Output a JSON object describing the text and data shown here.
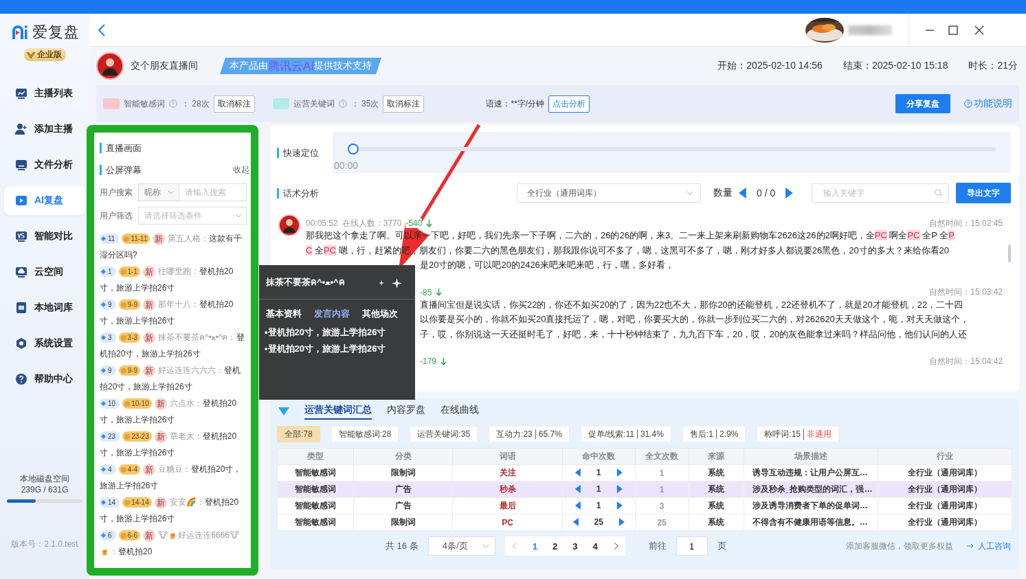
{
  "app": {
    "name": "爱复盘",
    "edition": "企业版"
  },
  "nav": [
    {
      "label": "主播列表",
      "kind": "chart",
      "selected": false
    },
    {
      "label": "添加主播",
      "kind": "user-plus",
      "selected": false
    },
    {
      "label": "文件分析",
      "kind": "monitor",
      "selected": false
    },
    {
      "label": "AI复盘",
      "kind": "play",
      "selected": true
    },
    {
      "label": "智能对比",
      "kind": "vs",
      "selected": false
    },
    {
      "label": "云空间",
      "kind": "cloud",
      "selected": false
    },
    {
      "label": "本地词库",
      "kind": "book",
      "selected": false
    },
    {
      "label": "系统设置",
      "kind": "gear",
      "selected": false
    },
    {
      "label": "帮助中心",
      "kind": "help",
      "selected": false
    }
  ],
  "disk": {
    "label": "本地磁盘空间",
    "usage": "239G / 631G",
    "level": 0.38
  },
  "version": "版本号：2.1.0.test",
  "stream": {
    "name": "交个朋友直播间",
    "banner": [
      {
        "text": "本产品由",
        "strong": false
      },
      {
        "text": "腾讯云AI",
        "strong": true
      },
      {
        "text": "提供技术支持",
        "strong": false
      }
    ],
    "start": "开始：2025-02-10 14:56",
    "end": "结束：2025-02-10 15:18",
    "duration": "时长：21分"
  },
  "legend": [
    {
      "label": "智能敏感词",
      "count": "： 28次",
      "action": "取消标注",
      "color": "#fbc5cd"
    },
    {
      "label": "运营关键词",
      "count": "： 35次",
      "action": "取消标注",
      "color": "#b3ebe8"
    }
  ],
  "speed": {
    "label": "语速：**字/分钟",
    "action": "点击分析"
  },
  "share_button": "分享复盘",
  "help_link": "功能说明",
  "left_panel": {
    "video_title": "直播画面",
    "danmaku_title": "公屏弹幕",
    "collapse": "收起",
    "search_label": "用户搜索",
    "search_type": "昵称",
    "search_placeholder": "请输入搜索",
    "filter_label": "用户筛选",
    "filter_placeholder": "请选择筛选条件",
    "comments": [
      {
        "level": "11",
        "fan": "11-11",
        "tag": "新",
        "name": "第五人格：",
        "text": "这款有干湿分区吗?"
      },
      {
        "level": "1",
        "fan": "1-1",
        "tag": "新",
        "name": "往哪里跑：",
        "text": "登机拍20寸，旅游上学拍26寸"
      },
      {
        "level": "9",
        "fan": "9-9",
        "tag": "新",
        "name": "那年十八：",
        "text": "登机拍20寸，旅游上学拍26寸"
      },
      {
        "level": "3",
        "fan": "3-3",
        "tag": "新",
        "name": "抹茶不要茶ค^•ﻌ•^ค：",
        "text": "登机拍20寸，旅游上学拍26寸"
      },
      {
        "level": "9",
        "fan": "9-9",
        "tag": "新",
        "name": "好运连连六六六：",
        "text": "登机拍20寸，旅游上学拍26寸"
      },
      {
        "level": "10",
        "fan": "10-10",
        "tag": "新",
        "name": "六点水：",
        "text": "登机拍20寸，旅游上学拍26寸"
      },
      {
        "level": "23",
        "fan": "23-23",
        "tag": "新",
        "name": "章老大：",
        "text": "登机拍20寸，旅游上学拍26寸"
      },
      {
        "level": "4",
        "fan": "4-4",
        "tag": "新",
        "name": "豆糖豆：",
        "text": "登机拍20寸，旅游上学拍26寸"
      },
      {
        "level": "14",
        "fan": "14-14",
        "tag": "新",
        "name": "安安🌈：",
        "text": "登机拍20寸，旅游上学拍26寸"
      },
      {
        "level": "6",
        "fan": "6-6",
        "tag": "新",
        "name": "🐮🍺好运连连6666🐮🍺：",
        "text": "登机拍20"
      }
    ]
  },
  "quick_locate": {
    "label": "快速定位",
    "time": "00:00",
    "level": 0
  },
  "analysis": {
    "label": "话术分析",
    "industry": "全行业（通用词库）",
    "count_label": "数量",
    "count": "0 / 0",
    "search_placeholder": "输入关键字",
    "export": "导出文字",
    "entries": [
      {
        "covered": false,
        "time": "00:05:52",
        "online": "在线人数：3770",
        "delta": "-540",
        "natural_time": "自然时间：15:02:45",
        "lines": [
          {
            "covered": false,
            "segments": [
              {
                "text": "那我把这个拿走了啊。可以亲一下吧，好吧，我们先亲一下子啊，二六的，26的26的啊，来3。二一来上架来刷新购物车2626这26的2啊好吧，全",
                "highlight": false
              },
              {
                "text": "PC",
                "highlight": true
              },
              {
                "text": " 啊全",
                "highlight": false
              },
              {
                "text": "PC",
                "highlight": true
              },
              {
                "text": " 全P 全",
                "highlight": false
              },
              {
                "text": "P",
                "highlight": true
              }
            ]
          },
          {
            "covered": false,
            "segments": [
              {
                "text": "C",
                "highlight": true
              },
              {
                "text": " 全",
                "highlight": false
              },
              {
                "text": "PC",
                "highlight": true
              },
              {
                "text": " 嗯，行，赶紧的吧，朋友们，你要二六的黑色朋友们，那我跟你说可不多了，嗯，这黑可不多了，嗯，刚才好多人都说要26黑色，20寸的多大？来给你看20",
                "highlight": false
              }
            ]
          },
          {
            "covered": true,
            "segments": [
              {
                "text": "是20寸的嗯，可以吧20的2426来吧来吧来吧，行，嘿，多好看，",
                "highlight": false
              }
            ]
          }
        ]
      },
      {
        "covered": true,
        "delta": "-85",
        "natural_time": "自然时间：15:03:42",
        "lines": [
          {
            "covered": true,
            "segments": [
              {
                "text": "直播间宝但是说实话，你买22的，你还不如买20的了，因为22也不大，那你20的还能登机，22还登机不了，就是20才能登机，22，二十四",
                "highlight": false
              }
            ]
          },
          {
            "covered": true,
            "segments": [
              {
                "text": "以你要是买小的，你就不如买20直接托运了，嗯，对吧，你要买大的，你就一步到位买二六的，对262620天天做这个，呃，对天天做这个，",
                "highlight": false
              }
            ]
          },
          {
            "covered": true,
            "segments": [
              {
                "text": "子，哎，你别说这一天还挺时毛了，好吧，来，十十秒钟结束了，九九百下车，20，哎，20的灰色能拿过来吗？样品问他，他们认问的人还",
                "highlight": false
              }
            ]
          }
        ]
      },
      {
        "covered": true,
        "delta": "-179",
        "natural_time": "自然时间：15:04:42"
      }
    ]
  },
  "popup": {
    "title": "抹茶不要茶ค^•ﻌ•^ค",
    "tabs": [
      {
        "label": "基本资料",
        "selected": false
      },
      {
        "label": "发言内容",
        "selected": true
      },
      {
        "label": "其他场次",
        "selected": false
      }
    ],
    "lines": [
      "•登机拍20寸，旅游上学拍26寸",
      "•登机拍20寸，旅游上学拍26寸"
    ]
  },
  "summary": {
    "tabs": [
      {
        "label": "运营关键词汇总",
        "selected": true
      },
      {
        "label": "内容罗盘",
        "selected": false
      },
      {
        "label": "在线曲线",
        "selected": false
      }
    ],
    "chips": [
      {
        "label": "全部:78",
        "selected": true,
        "flagged": false
      },
      {
        "label": "智能敏感词:28",
        "selected": false,
        "flagged": false
      },
      {
        "label": "运营关键词:35",
        "selected": false,
        "flagged": false
      },
      {
        "label": "互动力:23",
        "extra": "65.7%",
        "selected": false,
        "flagged": false
      },
      {
        "label": "促单/线索:11",
        "extra": "31.4%",
        "selected": false,
        "flagged": false
      },
      {
        "label": "售后:1",
        "extra": "2.9%",
        "selected": false,
        "flagged": false
      },
      {
        "label": "称呼词:15",
        "extra": "非通用",
        "selected": false,
        "flagged": true
      }
    ],
    "columns": [
      "类型",
      "分类",
      "词语",
      "命中次数",
      "全文次数",
      "来源",
      "场景描述",
      "行业"
    ],
    "rows": [
      {
        "type": "智能敏感词",
        "category": "限制词",
        "word": "关注",
        "hits": "1",
        "total": "1",
        "source": "系统",
        "scene": "诱导互动违规：让用户公屏互…",
        "industry": "全行业（通用词库）",
        "selected": false
      },
      {
        "type": "智能敏感词",
        "category": "广告",
        "word": "秒杀",
        "hits": "1",
        "total": "1",
        "source": "系统",
        "scene": "涉及秒杀_抢购类型的词汇，强…",
        "industry": "全行业（通用词库）",
        "selected": true
      },
      {
        "type": "智能敏感词",
        "category": "广告",
        "word": "最后",
        "hits": "1",
        "total": "3",
        "source": "系统",
        "scene": "涉及诱导消费者下单的促单词…",
        "industry": "全行业（通用词库）",
        "selected": false
      },
      {
        "type": "智能敏感词",
        "category": "限制词",
        "word": "PC",
        "hits": "25",
        "total": "25",
        "source": "系统",
        "scene": "不得含有不健康用语等信息。…",
        "industry": "全行业（通用词库）",
        "selected": false
      }
    ],
    "pagination": {
      "total": "共 16 条",
      "page_size": "4条/页",
      "pages": [
        {
          "label": "1",
          "selected": true
        },
        {
          "label": "2",
          "selected": false
        },
        {
          "label": "3",
          "selected": false
        },
        {
          "label": "4",
          "selected": false
        }
      ],
      "goto_label": "前往",
      "goto_value": "1",
      "page_unit": "页",
      "promo": "添加客服微信，领取更多权益",
      "consult": "人工咨询"
    }
  }
}
